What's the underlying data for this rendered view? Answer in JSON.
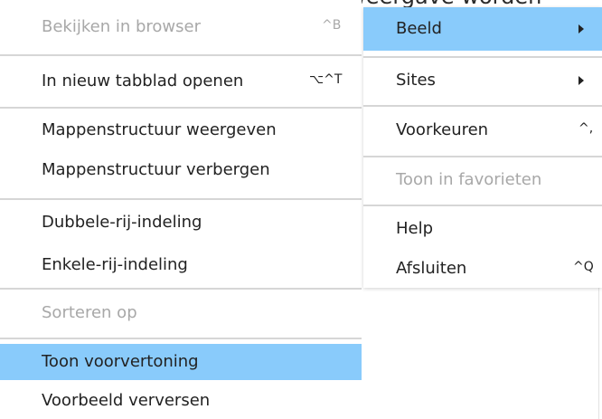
{
  "background": {
    "caption_fragment": "via het menu kan de voorbeeldweergave worden"
  },
  "colors": {
    "highlight": "#89cbfb",
    "disabled_text": "#a8a8a8",
    "separator": "#d6d6d6"
  },
  "left_menu": {
    "items": [
      {
        "label": "Bekijken in browser",
        "shortcut": "^B",
        "disabled": true
      },
      {
        "label": "In nieuw tabblad openen",
        "shortcut": "⌥^T"
      },
      {
        "label": "Mappenstructuur weergeven"
      },
      {
        "label": "Mappenstructuur verbergen"
      },
      {
        "label": "Dubbele-rij-indeling"
      },
      {
        "label": "Enkele-rij-indeling"
      },
      {
        "label": "Sorteren op",
        "disabled": true
      },
      {
        "label": "Toon voorvertoning",
        "highlighted": true
      },
      {
        "label": "Voorbeeld verversen"
      }
    ]
  },
  "right_menu": {
    "items": [
      {
        "label": "Beeld",
        "submenu_icon": "submenu-arrow-icon",
        "highlighted": true
      },
      {
        "label": "Sites",
        "submenu_icon": "submenu-arrow-icon"
      },
      {
        "label": "Voorkeuren",
        "shortcut": "^,"
      },
      {
        "label": "Toon in favorieten",
        "disabled": true
      },
      {
        "label": "Help"
      },
      {
        "label": "Afsluiten",
        "shortcut": "^Q"
      }
    ]
  }
}
